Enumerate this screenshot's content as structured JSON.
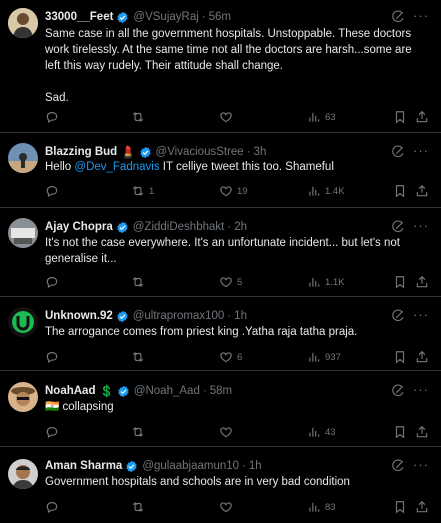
{
  "tweets": [
    {
      "name": "33000__Feet",
      "handle": "@VSujayRaj",
      "time": "56m",
      "badge": "",
      "verified": true,
      "text_lines": [
        "Same case in all the government hospitals. Unstoppable. These doctors",
        "work tirelessly. At the same time not all the doctors are harsh...some are",
        "left this way rudely. Their attitude shall change.",
        "",
        "Sad."
      ],
      "replies": "",
      "reposts": "",
      "likes": "",
      "views": "63"
    },
    {
      "name": "Blazzing Bud",
      "handle": "@VivaciousStree",
      "time": "3h",
      "badge": "💄",
      "verified": true,
      "text_before": "Hello ",
      "mention": "@Dev_Fadnavis",
      "text_after": " IT celliye tweet this too. Shameful",
      "replies": "",
      "reposts": "1",
      "likes": "19",
      "views": "1.4K"
    },
    {
      "name": "Ajay Chopra",
      "handle": "@ZiddiDeshbhakt",
      "time": "2h",
      "badge": "",
      "verified": true,
      "text_lines": [
        "It's not the case everywhere. It's an unfortunate incident... but let's not",
        "generalise it..."
      ],
      "replies": "",
      "reposts": "",
      "likes": "5",
      "views": "1.1K"
    },
    {
      "name": "Unknown.92",
      "handle": "@ultrapromax100",
      "time": "1h",
      "badge": "",
      "verified": true,
      "text_lines": [
        "The arrogance comes from priest king .Yatha raja tatha praja."
      ],
      "replies": "",
      "reposts": "",
      "likes": "6",
      "views": "937"
    },
    {
      "name": "NoahAad",
      "handle": "@Noah_Aad",
      "time": "58m",
      "badge": "💲",
      "verified": true,
      "text_lines": [
        "🇮🇳 collapsing"
      ],
      "replies": "",
      "reposts": "",
      "likes": "",
      "views": "43"
    },
    {
      "name": "Aman Sharma",
      "handle": "@gulaabjaamun10",
      "time": "1h",
      "badge": "",
      "verified": true,
      "text_lines": [
        "Government hospitals and schools are in very bad condition"
      ],
      "replies": "",
      "reposts": "",
      "likes": "",
      "views": "83"
    }
  ],
  "colors": {
    "background": "#000000",
    "text": "#e7e9ea",
    "muted": "#71767b",
    "accent": "#1d9bf0",
    "divider": "#2f3336"
  },
  "icons": [
    "reply-icon",
    "repost-icon",
    "like-icon",
    "views-icon",
    "bookmark-icon",
    "share-icon",
    "grok-icon",
    "more-icon",
    "verified-icon"
  ]
}
